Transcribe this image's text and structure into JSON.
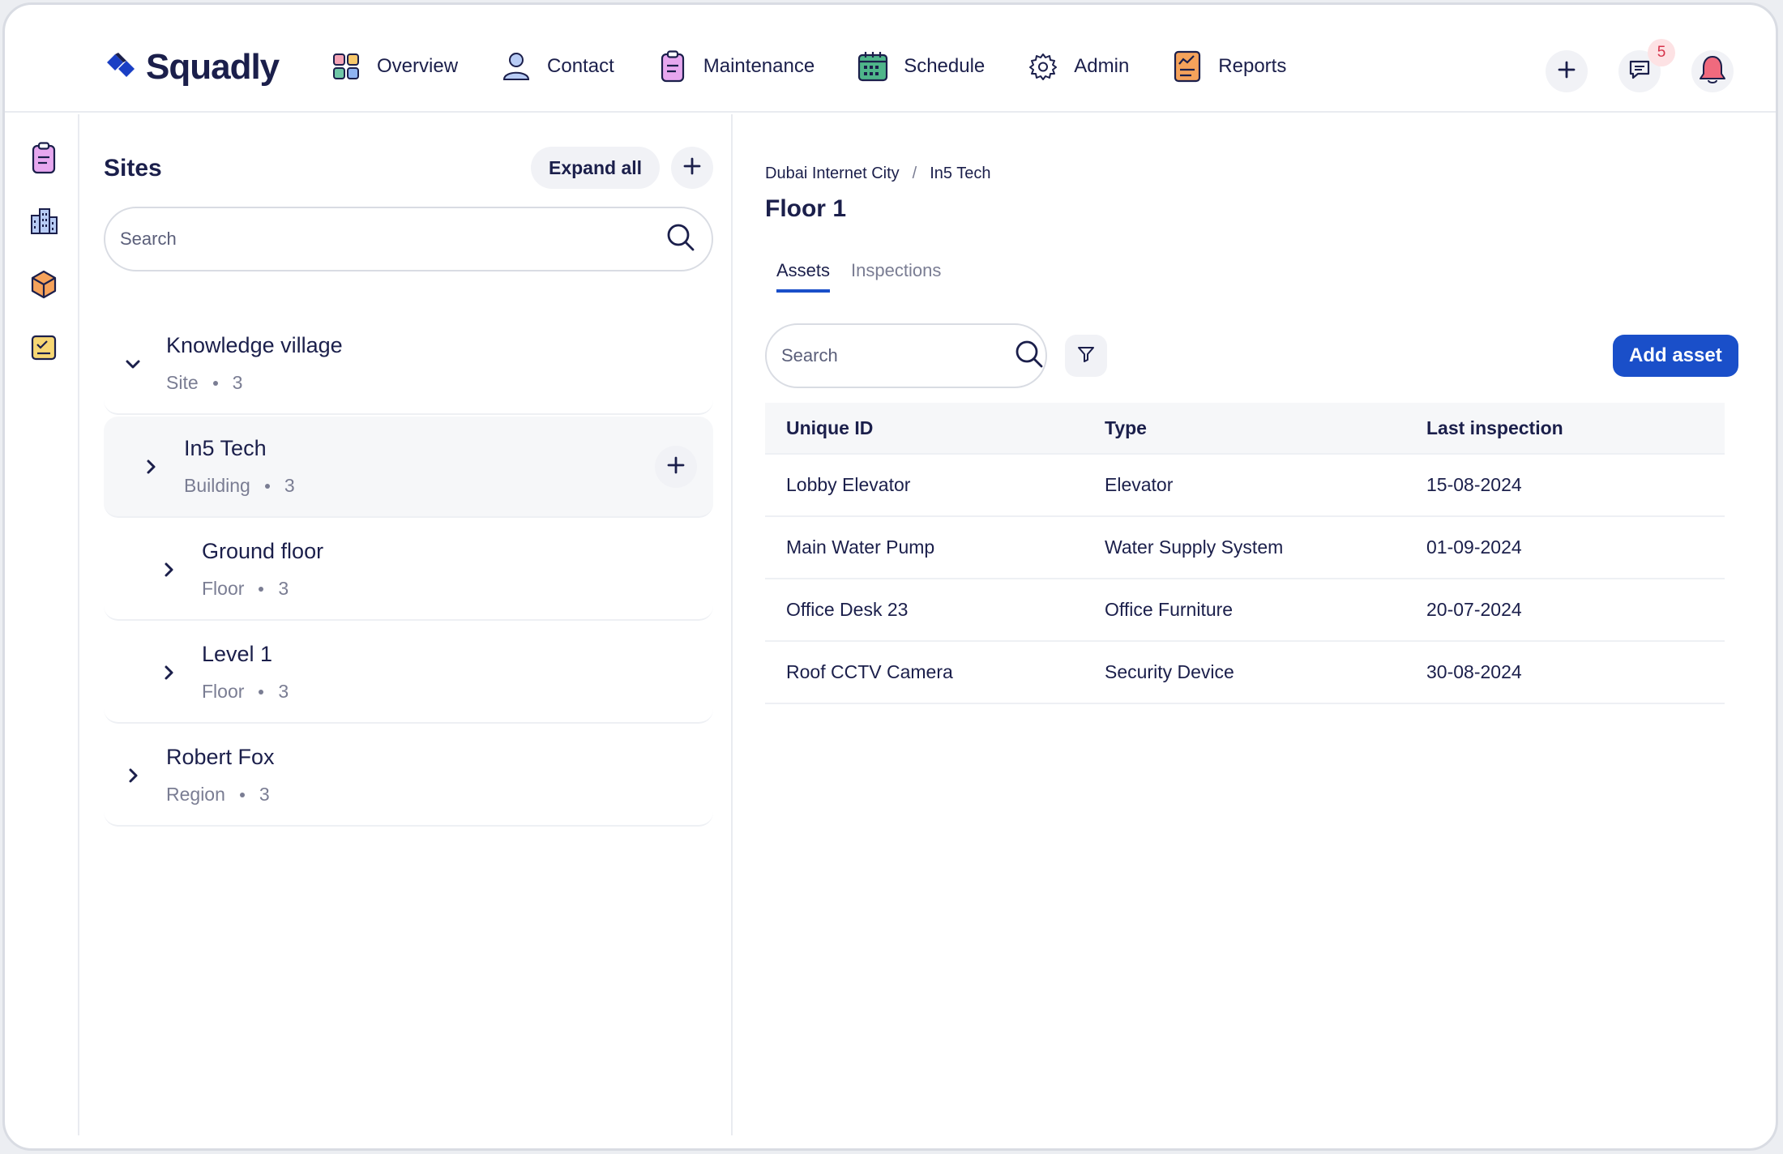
{
  "app": {
    "brand": "Squadly"
  },
  "nav": {
    "items": [
      {
        "label": "Overview",
        "icon": "grid-icon"
      },
      {
        "label": "Contact",
        "icon": "user-icon"
      },
      {
        "label": "Maintenance",
        "icon": "clipboard-icon"
      },
      {
        "label": "Schedule",
        "icon": "calendar-icon"
      },
      {
        "label": "Admin",
        "icon": "gear-icon"
      },
      {
        "label": "Reports",
        "icon": "report-icon"
      }
    ],
    "messages_badge": "5"
  },
  "sidebar": {
    "rail_icons": [
      "clipboard-icon",
      "building-icon",
      "box-icon",
      "checklist-icon"
    ]
  },
  "sites": {
    "title": "Sites",
    "expand_label": "Expand all",
    "search_placeholder": "Search",
    "tree": [
      {
        "name": "Knowledge village",
        "kind": "Site",
        "count": "3",
        "expanded": true
      },
      {
        "name": "In5 Tech",
        "kind": "Building",
        "count": "3",
        "expanded": false,
        "active": true
      },
      {
        "name": "Ground floor",
        "kind": "Floor",
        "count": "3",
        "expanded": false
      },
      {
        "name": "Level 1",
        "kind": "Floor",
        "count": "3",
        "expanded": false
      },
      {
        "name": "Robert Fox",
        "kind": "Region",
        "count": "3",
        "expanded": false
      }
    ]
  },
  "main": {
    "breadcrumb": [
      "Dubai Internet City",
      "In5 Tech"
    ],
    "breadcrumb_sep": "/",
    "title": "Floor 1",
    "tabs": [
      {
        "label": "Assets",
        "active": true
      },
      {
        "label": "Inspections",
        "active": false
      }
    ],
    "search_placeholder": "Search",
    "add_asset_label": "Add asset",
    "table": {
      "columns": [
        "Unique ID",
        "Type",
        "Last inspection"
      ],
      "rows": [
        [
          "Lobby Elevator",
          "Elevator",
          "15-08-2024"
        ],
        [
          "Main Water Pump",
          "Water Supply System",
          "01-09-2024"
        ],
        [
          "Office Desk 23",
          "Office Furniture",
          "20-07-2024"
        ],
        [
          "Roof CCTV Camera",
          "Security Device",
          "30-08-2024"
        ]
      ]
    }
  },
  "colors": {
    "primary": "#1a4fc9",
    "text": "#1b1f4b",
    "muted": "#7a7d93",
    "badge_text": "#d6334a",
    "badge_bg": "#fde2e4"
  }
}
